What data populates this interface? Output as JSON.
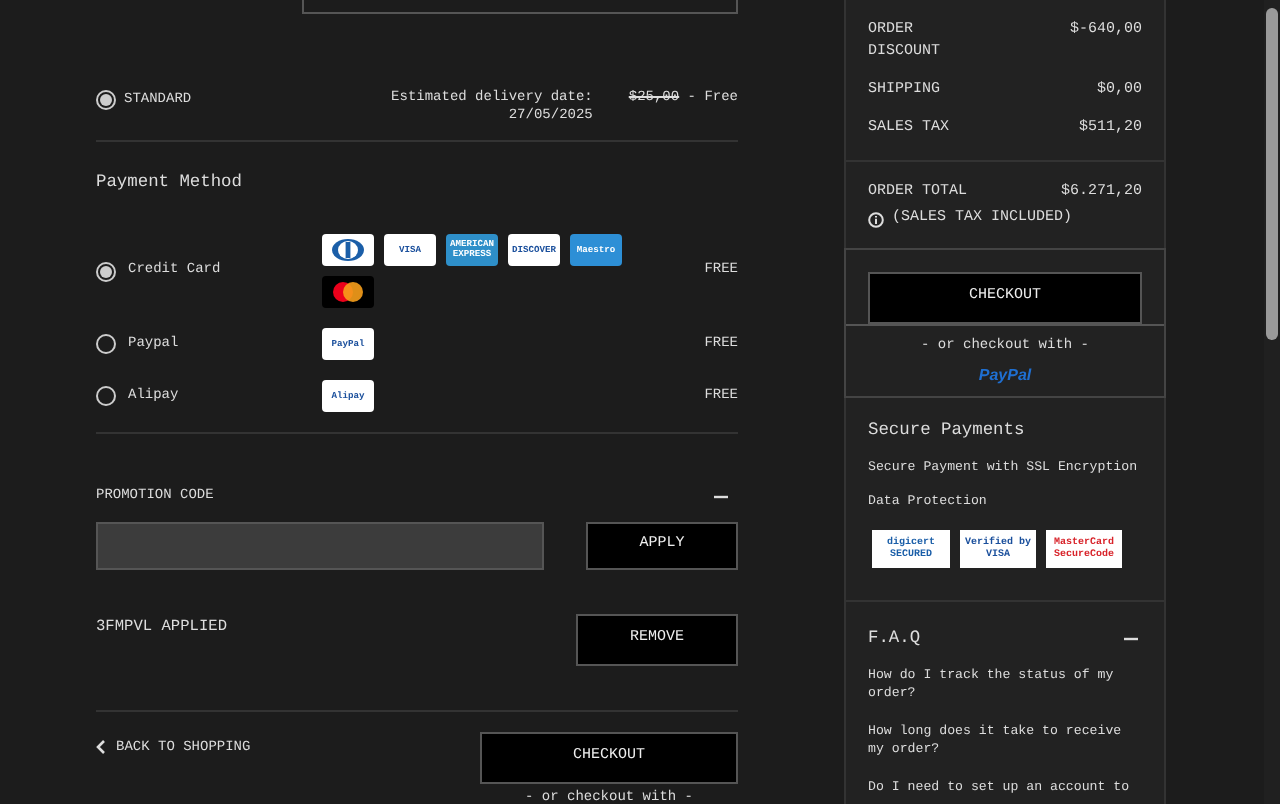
{
  "shipping_options": [
    {
      "label": "STANDARD",
      "selected": true,
      "estimate": "Estimated delivery date: 27/05/2025",
      "old_price": "$25,00",
      "price": "- Free"
    }
  ],
  "payment": {
    "title": "Payment Method",
    "methods": [
      {
        "label": "Credit Card",
        "selected": true,
        "price": "FREE",
        "logos": [
          {
            "kind": "diners"
          },
          {
            "kind": "badge",
            "label": "VISA",
            "color": "#ffffff"
          },
          {
            "kind": "badge",
            "label": "AMERICAN EXPRESS",
            "color": "#2e8fc9"
          },
          {
            "kind": "badge",
            "label": "DISCOVER",
            "color": "#ffffff"
          },
          {
            "kind": "badge",
            "label": "Maestro",
            "color": "#2d8fd6"
          },
          {
            "kind": "mastercard"
          }
        ]
      },
      {
        "label": "Paypal",
        "selected": false,
        "price": "FREE",
        "logos": [
          {
            "kind": "badge",
            "label": "PayPal",
            "color": "#ffffff"
          }
        ]
      },
      {
        "label": "Alipay",
        "selected": false,
        "price": "FREE",
        "logos": [
          {
            "kind": "badge",
            "label": "Alipay",
            "color": "#ffffff"
          }
        ]
      }
    ]
  },
  "promotion": {
    "title": "PROMOTION CODE",
    "expanded": true,
    "apply": "APPLY",
    "applied": "3FMPVL APPLIED",
    "remove": "REMOVE"
  },
  "footer": {
    "back": "BACK TO SHOPPING",
    "checkout": "CHECKOUT",
    "alternative": "- or checkout with -"
  },
  "summary": {
    "rows": [
      {
        "label": "ORDER DISCOUNT",
        "value": "$-640,00"
      },
      {
        "label": "SHIPPING",
        "value": "$0,00"
      },
      {
        "label": "SALES TAX",
        "value": "$511,20"
      }
    ],
    "total": {
      "label": "ORDER TOTAL",
      "value": "$6.271,20",
      "note": "(SALES TAX INCLUDED)"
    },
    "checkout": "CHECKOUT",
    "alternative": "- or checkout with -",
    "paypal": "PayPal"
  },
  "secure": {
    "title": "Secure Payments",
    "lines": [
      "Secure Payment with SSL Encryption",
      "Data Protection"
    ],
    "badges": [
      {
        "label": "digicert SECURED"
      },
      {
        "label": "Verified by VISA"
      },
      {
        "label": "MasterCard SecureCode"
      }
    ]
  },
  "faq": {
    "title": "F.A.Q",
    "expanded": true,
    "questions": [
      "How do I track the status of my order?",
      "How long does it take to receive my order?",
      "Do I need to set up an account to"
    ]
  }
}
